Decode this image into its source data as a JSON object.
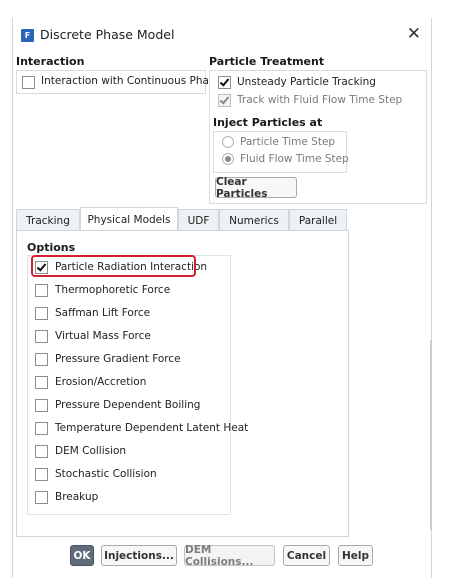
{
  "window": {
    "title": "Discrete Phase Model",
    "app_icon": "F"
  },
  "interaction": {
    "heading": "Interaction",
    "items": [
      {
        "label": "Interaction with Continuous Phase",
        "checked": false
      }
    ]
  },
  "particle_treatment": {
    "heading": "Particle Treatment",
    "items": [
      {
        "label": "Unsteady Particle Tracking",
        "checked": true,
        "enabled": true
      },
      {
        "label": "Track with Fluid Flow Time Step",
        "checked": true,
        "enabled": false
      }
    ],
    "inject_heading": "Inject Particles at",
    "inject_options": [
      {
        "label": "Particle Time Step",
        "selected": false
      },
      {
        "label": "Fluid Flow Time Step",
        "selected": true
      }
    ],
    "clear_button": "Clear Particles"
  },
  "tabs": [
    {
      "label": "Tracking",
      "active": false
    },
    {
      "label": "Physical Models",
      "active": true
    },
    {
      "label": "UDF",
      "active": false
    },
    {
      "label": "Numerics",
      "active": false
    },
    {
      "label": "Parallel",
      "active": false
    }
  ],
  "options": {
    "heading": "Options",
    "items": [
      {
        "label": "Particle Radiation Interaction",
        "checked": true
      },
      {
        "label": "Thermophoretic Force",
        "checked": false
      },
      {
        "label": "Saffman Lift Force",
        "checked": false
      },
      {
        "label": "Virtual Mass Force",
        "checked": false
      },
      {
        "label": "Pressure Gradient Force",
        "checked": false
      },
      {
        "label": "Erosion/Accretion",
        "checked": false
      },
      {
        "label": "Pressure Dependent Boiling",
        "checked": false
      },
      {
        "label": "Temperature Dependent Latent Heat",
        "checked": false
      },
      {
        "label": "DEM Collision",
        "checked": false
      },
      {
        "label": "Stochastic Collision",
        "checked": false
      },
      {
        "label": "Breakup",
        "checked": false
      }
    ]
  },
  "buttons": {
    "ok": "OK",
    "injections": "Injections...",
    "dem_collisions": "DEM Collisions...",
    "cancel": "Cancel",
    "help": "Help"
  },
  "colors": {
    "highlight": "#d0232f",
    "ok_button": "#5f6b78",
    "app_icon": "#2a63b8"
  }
}
